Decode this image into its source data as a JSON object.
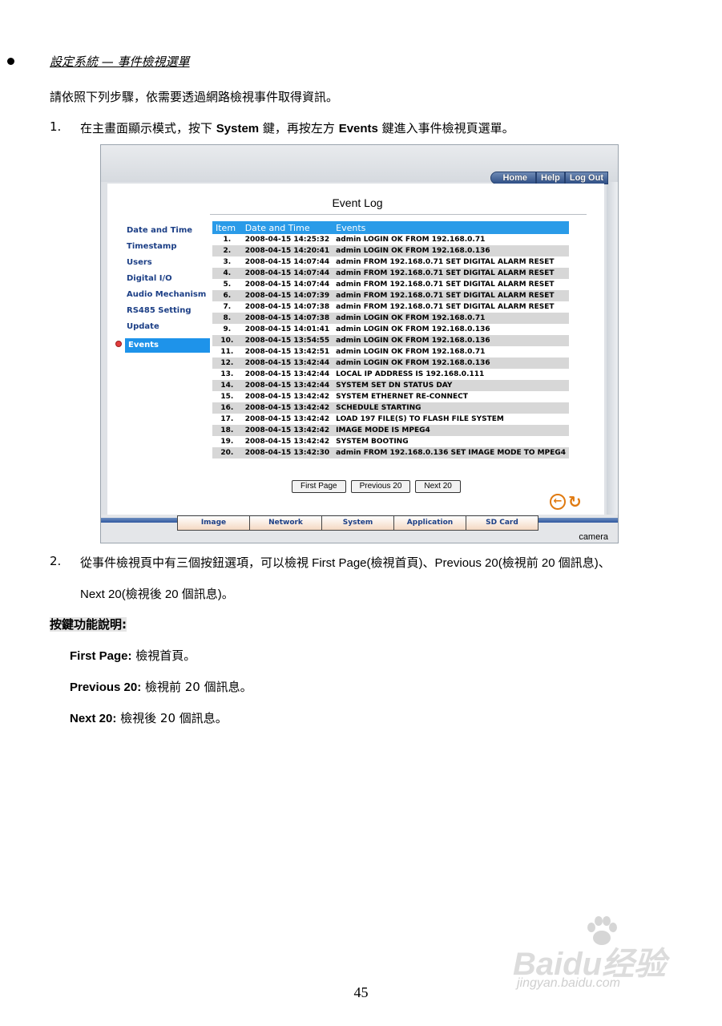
{
  "section": {
    "title": "設定系統 — 事件檢視選單"
  },
  "intro": "請依照下列步驟，依需要透過網路檢視事件取得資訊。",
  "step1": {
    "num": "1.",
    "pre": "在主畫面顯示模式，按下 ",
    "bold1": "System",
    "mid": " 鍵，再按左方 ",
    "bold2": "Events",
    "post": " 鍵進入事件檢視頁選單。"
  },
  "screenshot": {
    "top_nav": [
      "Home",
      "Help",
      "Log Out"
    ],
    "title": "Event Log",
    "side_menu": [
      "Date and Time",
      "Timestamp",
      "Users",
      "Digital I/O",
      "Audio Mechanism",
      "RS485 Setting",
      "Update",
      "Events"
    ],
    "table": {
      "headers": [
        "Item",
        "Date and Time",
        "Events"
      ],
      "rows": [
        [
          "1.",
          "2008-04-15 14:25:32",
          "admin LOGIN OK FROM 192.168.0.71"
        ],
        [
          "2.",
          "2008-04-15 14:20:41",
          "admin LOGIN OK FROM 192.168.0.136"
        ],
        [
          "3.",
          "2008-04-15 14:07:44",
          "admin FROM 192.168.0.71 SET DIGITAL ALARM RESET"
        ],
        [
          "4.",
          "2008-04-15 14:07:44",
          "admin FROM 192.168.0.71 SET DIGITAL ALARM RESET"
        ],
        [
          "5.",
          "2008-04-15 14:07:44",
          "admin FROM 192.168.0.71 SET DIGITAL ALARM RESET"
        ],
        [
          "6.",
          "2008-04-15 14:07:39",
          "admin FROM 192.168.0.71 SET DIGITAL ALARM RESET"
        ],
        [
          "7.",
          "2008-04-15 14:07:38",
          "admin FROM 192.168.0.71 SET DIGITAL ALARM RESET"
        ],
        [
          "8.",
          "2008-04-15 14:07:38",
          "admin LOGIN OK FROM 192.168.0.71"
        ],
        [
          "9.",
          "2008-04-15 14:01:41",
          "admin LOGIN OK FROM 192.168.0.136"
        ],
        [
          "10.",
          "2008-04-15 13:54:55",
          "admin LOGIN OK FROM 192.168.0.136"
        ],
        [
          "11.",
          "2008-04-15 13:42:51",
          "admin LOGIN OK FROM 192.168.0.71"
        ],
        [
          "12.",
          "2008-04-15 13:42:44",
          "admin LOGIN OK FROM 192.168.0.136"
        ],
        [
          "13.",
          "2008-04-15 13:42:44",
          "LOCAL IP ADDRESS IS 192.168.0.111"
        ],
        [
          "14.",
          "2008-04-15 13:42:44",
          "SYSTEM SET DN STATUS DAY"
        ],
        [
          "15.",
          "2008-04-15 13:42:42",
          "SYSTEM ETHERNET RE-CONNECT"
        ],
        [
          "16.",
          "2008-04-15 13:42:42",
          "SCHEDULE STARTING"
        ],
        [
          "17.",
          "2008-04-15 13:42:42",
          "LOAD 197 FILE(S) TO FLASH FILE SYSTEM"
        ],
        [
          "18.",
          "2008-04-15 13:42:42",
          "IMAGE MODE IS MPEG4"
        ],
        [
          "19.",
          "2008-04-15 13:42:42",
          "SYSTEM BOOTING"
        ],
        [
          "20.",
          "2008-04-15 13:42:30",
          "admin FROM 192.168.0.136 SET IMAGE MODE TO MPEG4"
        ]
      ]
    },
    "page_buttons": [
      "First Page",
      "Previous 20",
      "Next 20"
    ],
    "bottom_tabs": [
      "Image",
      "Network",
      "System",
      "Application",
      "SD Card"
    ],
    "brand": "camera",
    "icons": [
      "back-arrow-icon",
      "refresh-icon"
    ]
  },
  "step2": {
    "num": "2.",
    "line1": "從事件檢視頁中有三個按鈕選項，可以檢視 First Page(檢視首頁)、Previous 20(檢視前 20 個訊息)、",
    "line2": "Next 20(檢視後 20 個訊息)。"
  },
  "key_heading": "按鍵功能說明:",
  "definitions": [
    {
      "term": "First Page:",
      "desc": " 檢視首頁。"
    },
    {
      "term": "Previous 20:",
      "desc": " 檢視前 20 個訊息。"
    },
    {
      "term": "Next 20:",
      "desc": " 檢視後 20 個訊息。"
    }
  ],
  "page_number": "45",
  "watermark": {
    "logo": "Baidu经验",
    "url": "jingyan.baidu.com"
  },
  "colors": {
    "table_header": "#2a9be8",
    "menu_text": "#1c3f86",
    "accent_orange": "#e07a10"
  }
}
